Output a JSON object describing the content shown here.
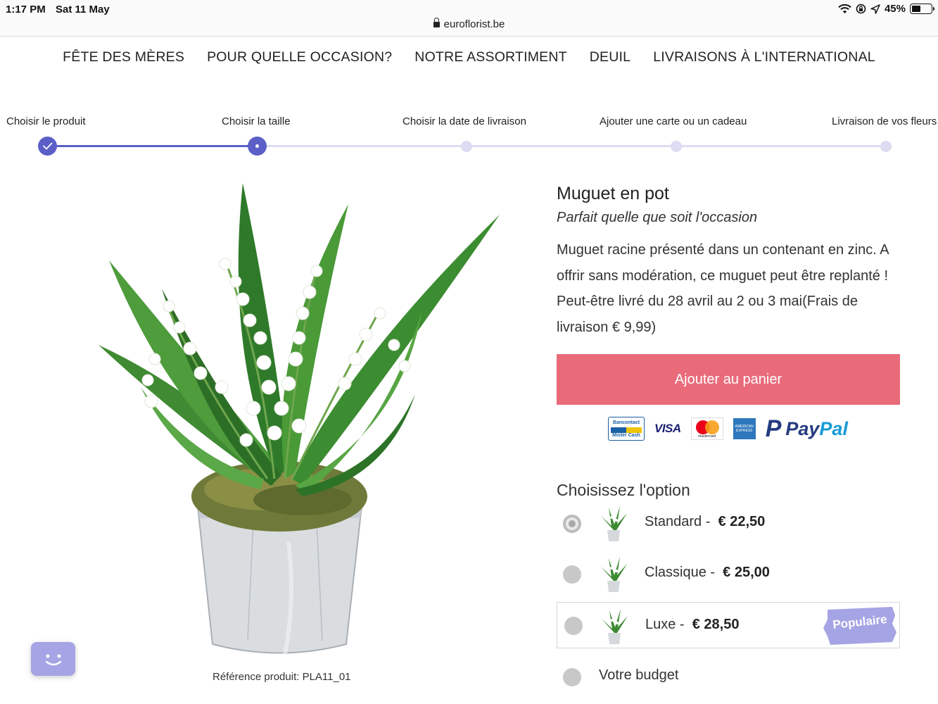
{
  "status_bar": {
    "time": "1:17 PM",
    "date": "Sat 11 May",
    "battery_percent": "45%",
    "battery_level": 0.45,
    "url": "euroflorist.be"
  },
  "nav": {
    "items": [
      "FÊTE DES MÈRES",
      "POUR QUELLE OCCASION?",
      "NOTRE ASSORTIMENT",
      "DEUIL",
      "LIVRAISONS À L'INTERNATIONAL"
    ]
  },
  "steps": [
    {
      "label": "Choisir le produit",
      "state": "done"
    },
    {
      "label": "Choisir la taille",
      "state": "current"
    },
    {
      "label": "Choisir la date de livraison",
      "state": "todo"
    },
    {
      "label": "Ajouter une carte ou un cadeau",
      "state": "todo"
    },
    {
      "label": "Livraison de vos fleurs",
      "state": "todo"
    }
  ],
  "colors": {
    "accent": "#5b5fc7",
    "step_inactive": "#dcdcf2",
    "cart_button": "#e96b7a",
    "badge": "#a5a4e4"
  },
  "product": {
    "title": "Muguet en pot",
    "subtitle": "Parfait quelle que soit l'occasion",
    "description": "Muguet racine présenté dans un contenant en zinc. A offrir sans modération, ce muguet peut être replanté ! Peut-être livré du 28 avril au 2 ou 3 mai(Frais de livraison € 9,99)",
    "reference": "Référence produit: PLA11_01",
    "cart_button": "Ajouter au panier"
  },
  "payments": {
    "bancontact_top": "Bancontact",
    "bancontact_bottom": "Mister Cash",
    "visa": "VISA",
    "mastercard": "mastercard",
    "amex": "AMERICAN EXPRESS",
    "paypal_pay": "Pay",
    "paypal_pal": "Pal"
  },
  "options": {
    "title": "Choisissez l'option",
    "items": [
      {
        "name": "Standard -",
        "price": "€ 22,50",
        "selected": true
      },
      {
        "name": "Classique -",
        "price": "€ 25,00",
        "selected": false
      },
      {
        "name": "Luxe -",
        "price": "€ 28,50",
        "selected": false,
        "badge": "Populaire"
      },
      {
        "name": "Votre budget",
        "price": "",
        "selected": false
      }
    ]
  },
  "icons": {
    "wifi": "wifi-icon",
    "lock": "lock-icon",
    "location": "location-icon",
    "checkmark": "check-icon",
    "chat": "chat-face-icon"
  }
}
